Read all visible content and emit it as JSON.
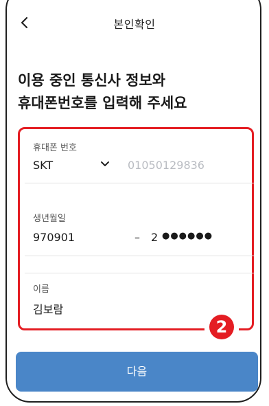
{
  "header": {
    "title": "본인확인",
    "back_icon": "chevron-left-icon"
  },
  "main": {
    "heading_line1": "이용 중인 통신사 정보와",
    "heading_line2": "휴대폰번호를 입력해 주세요"
  },
  "form": {
    "phone": {
      "label": "휴대폰 번호",
      "carrier": "SKT",
      "carrier_icon": "chevron-down-icon",
      "number": "01050129836"
    },
    "birth": {
      "label": "생년월일",
      "value": "970901",
      "dash": "–",
      "rrn_first_digit": "2",
      "rrn_mask": "●●●●●●"
    },
    "name": {
      "label": "이름",
      "value": "김보람"
    }
  },
  "annotation": {
    "step": "2",
    "color": "#e41d23"
  },
  "footer": {
    "next_label": "다음",
    "button_color": "#4a86c8"
  }
}
